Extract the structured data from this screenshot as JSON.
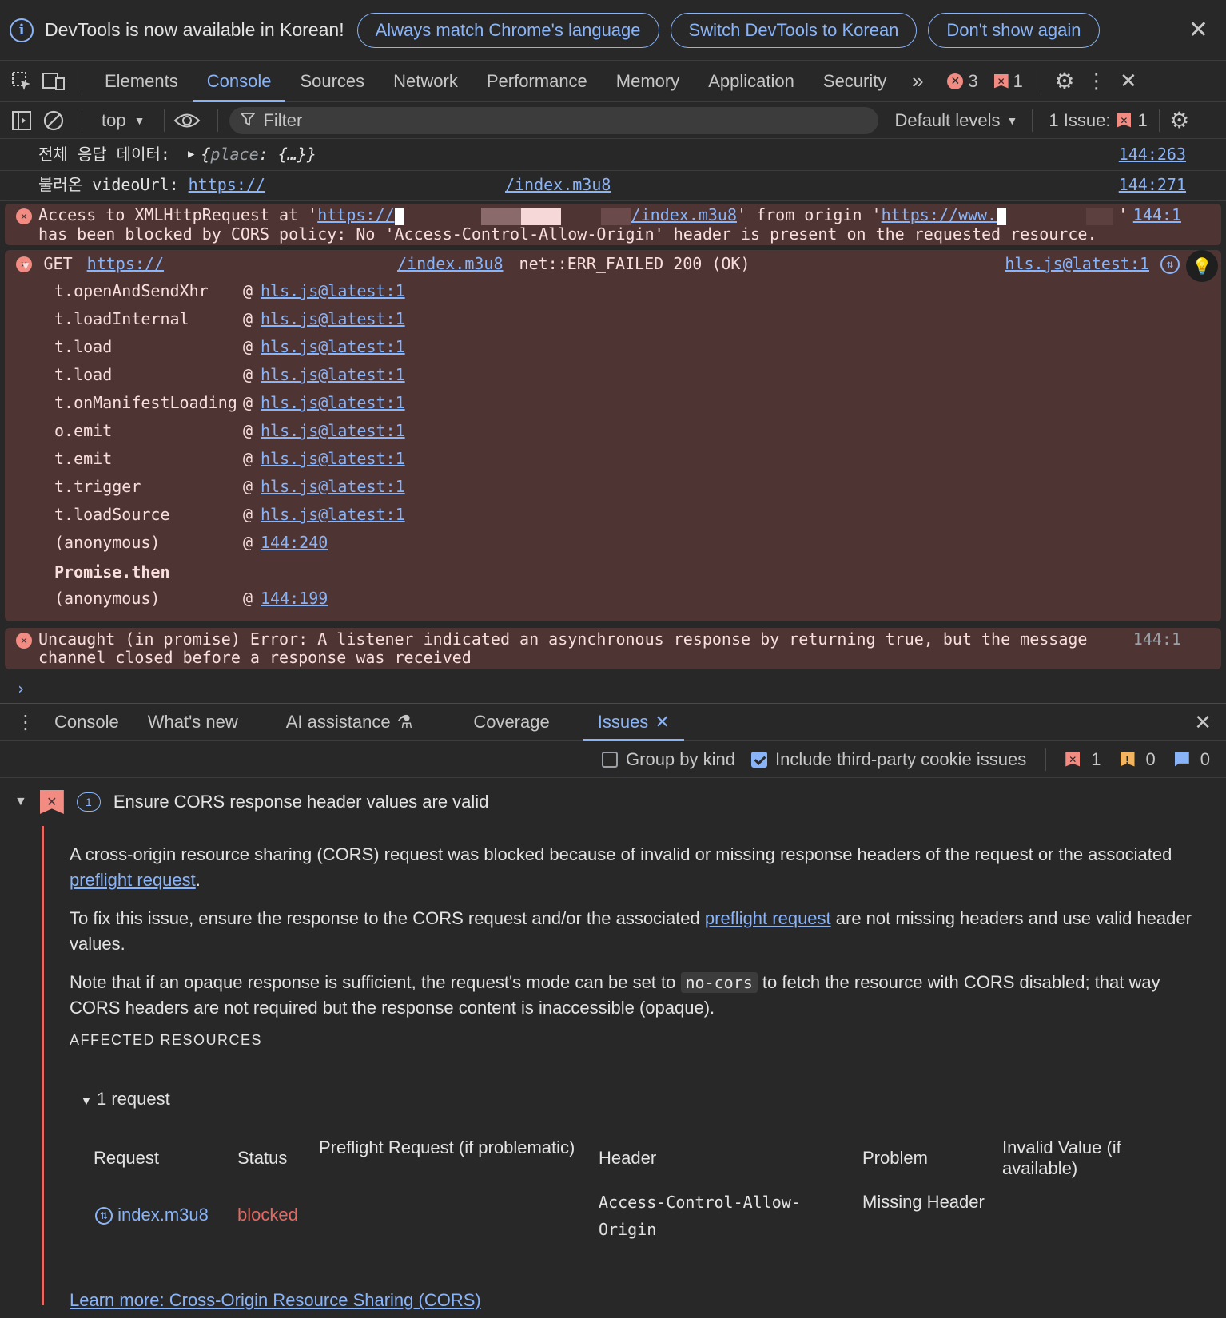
{
  "infobar": {
    "text": "DevTools is now available in Korean!",
    "btn_match": "Always match Chrome's language",
    "btn_switch": "Switch DevTools to Korean",
    "btn_dismiss": "Don't show again"
  },
  "tabs": {
    "elements": "Elements",
    "console": "Console",
    "sources": "Sources",
    "network": "Network",
    "performance": "Performance",
    "memory": "Memory",
    "application": "Application",
    "security": "Security",
    "errors_count": "3",
    "issues_count": "1"
  },
  "console_toolbar": {
    "context": "top",
    "filter_placeholder": "Filter",
    "levels": "Default levels",
    "issues_label": "1 Issue:",
    "issues_count": "1"
  },
  "messages": {
    "log1": {
      "label": "전체 응답 데이터:",
      "value": "{place: {…}}",
      "value_key": "place",
      "source": "144:263"
    },
    "log2": {
      "label": "불러온 videoUrl:",
      "url_start": "https://",
      "url_end": "/index.m3u8",
      "source": "144:271"
    },
    "cors": {
      "prefix": "Access to XMLHttpRequest at '",
      "url_start": "https://",
      "url_end": "/index.m3u8",
      "middle": "' from origin '",
      "origin": "https://www.",
      "suffix": "'",
      "line2": "has been blocked by CORS policy: No 'Access-Control-Allow-Origin' header is present on the requested resource.",
      "source": "144:1"
    },
    "get": {
      "method": "GET",
      "url_start": "https://",
      "url_end": "/index.m3u8",
      "status": "net::ERR_FAILED 200 (OK)",
      "source": "hls.js@latest:1",
      "trace": [
        {
          "fn": "t.openAndSendXhr",
          "loc": "hls.js@latest:1"
        },
        {
          "fn": "t.loadInternal",
          "loc": "hls.js@latest:1"
        },
        {
          "fn": "t.load",
          "loc": "hls.js@latest:1"
        },
        {
          "fn": "t.load",
          "loc": "hls.js@latest:1"
        },
        {
          "fn": "t.onManifestLoading",
          "loc": "hls.js@latest:1"
        },
        {
          "fn": "o.emit",
          "loc": "hls.js@latest:1"
        },
        {
          "fn": "t.emit",
          "loc": "hls.js@latest:1"
        },
        {
          "fn": "t.trigger",
          "loc": "hls.js@latest:1"
        },
        {
          "fn": "t.loadSource",
          "loc": "hls.js@latest:1"
        },
        {
          "fn": "(anonymous)",
          "loc": "144:240"
        }
      ],
      "async_label": "Promise.then",
      "last_fn": "(anonymous)",
      "last_loc": "144:199"
    },
    "uncaught": {
      "line1": "Uncaught (in promise) Error: A listener indicated an asynchronous response by returning true, but the message",
      "line2": "channel closed before a response was received",
      "source": "144:1"
    }
  },
  "drawer": {
    "tabs": {
      "console": "Console",
      "whats_new": "What's new",
      "ai": "AI assistance",
      "coverage": "Coverage",
      "issues": "Issues"
    },
    "group_by_kind": "Group by kind",
    "include_third_party": "Include third-party cookie issues",
    "count_errors": "1",
    "count_warnings": "0",
    "count_info": "0"
  },
  "issue": {
    "count": "1",
    "title": "Ensure CORS response header values are valid",
    "p1_a": "A cross-origin resource sharing (CORS) request was blocked because of invalid or missing response headers of the request or the associated ",
    "p1_link": "preflight request",
    "p1_b": ".",
    "p2_a": "To fix this issue, ensure the response to the CORS request and/or the associated ",
    "p2_link": "preflight request",
    "p2_b": " are not missing headers and use valid header values.",
    "p3_a": "Note that if an opaque response is sufficient, the request's mode can be set to ",
    "p3_code": "no-cors",
    "p3_b": " to fetch the resource with CORS disabled; that way CORS headers are not required but the response content is inaccessible (opaque).",
    "affected": "AFFECTED RESOURCES",
    "requests_label": "1 request",
    "table": {
      "headers": [
        "Request",
        "Status",
        "Preflight Request (if problematic)",
        "Header",
        "Problem",
        "Invalid Value (if available)"
      ],
      "row": {
        "request": "index.m3u8",
        "status": "blocked",
        "header": "Access-Control-Allow-Origin",
        "problem": "Missing Header"
      }
    },
    "learn_more": "Learn more: Cross-Origin Resource Sharing (CORS)"
  },
  "colors": {
    "accent": "#8ab4f8",
    "error": "#f28b82",
    "error_bg": "#4e3534",
    "blocked": "#e46962"
  }
}
